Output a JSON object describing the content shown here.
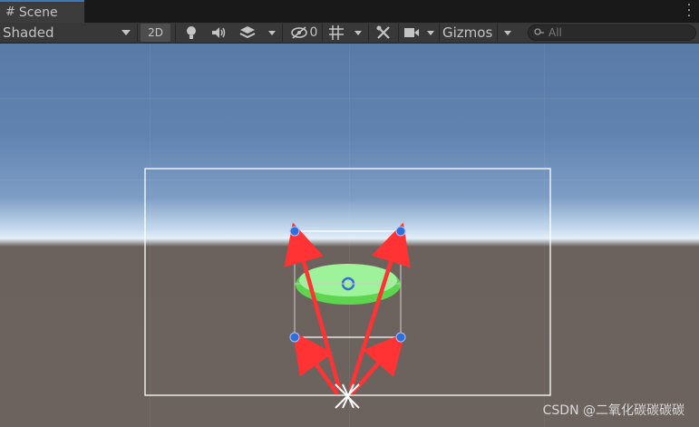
{
  "tab": {
    "title": "Scene",
    "icon": "hash-icon"
  },
  "toolbar": {
    "draw_mode": "Shaded",
    "mode_2d": "2D",
    "hidden_count": "0",
    "gizmos": "Gizmos",
    "search_placeholder": "All"
  },
  "icons": [
    "hash-icon",
    "menu-kebab-icon",
    "chevron-down-icon",
    "lightbulb-icon",
    "audio-icon",
    "effects-icon",
    "eye-slash-icon",
    "grid-icon",
    "tools-icon",
    "camera-icon",
    "search-icon"
  ],
  "colors": {
    "handle": "#2e6fd8",
    "gizmo_line": "#ffffff",
    "light_disc": "#86ef7a",
    "arrow": "#ff3333",
    "sky": "#6083b0",
    "ground": "#6c635e"
  },
  "watermark": "CSDN @二氧化碳碳碳碳"
}
